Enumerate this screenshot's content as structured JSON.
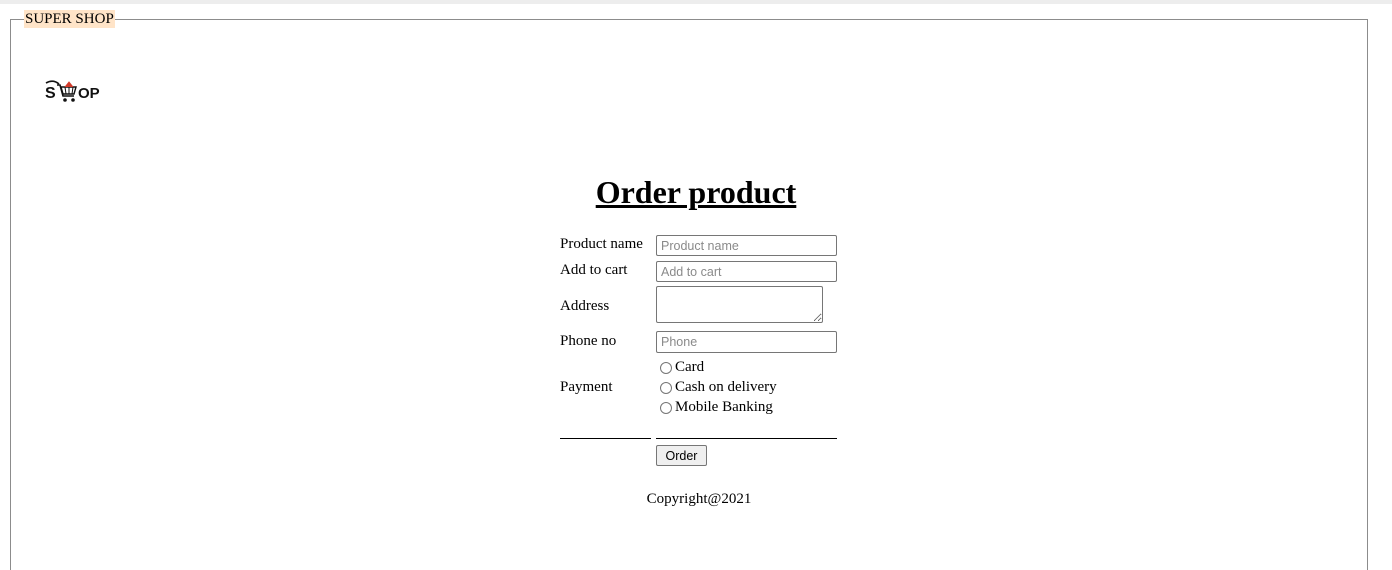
{
  "frame": {
    "legend": "SUPER SHOP"
  },
  "logo": {
    "text": "SHOP",
    "accent": "#d23a2a"
  },
  "page_title": "Order product",
  "form": {
    "product_name": {
      "label": "Product name",
      "placeholder": "Product name",
      "value": ""
    },
    "add_to_cart": {
      "label": "Add to cart",
      "placeholder": "Add to cart",
      "value": ""
    },
    "address": {
      "label": "Address",
      "value": ""
    },
    "phone": {
      "label": "Phone no",
      "placeholder": "Phone",
      "value": ""
    },
    "payment": {
      "label": "Payment",
      "options": [
        "Card",
        "Cash on delivery",
        "Mobile Banking"
      ]
    },
    "submit_label": "Order"
  },
  "footer": {
    "copyright": "Copyright@2021"
  }
}
